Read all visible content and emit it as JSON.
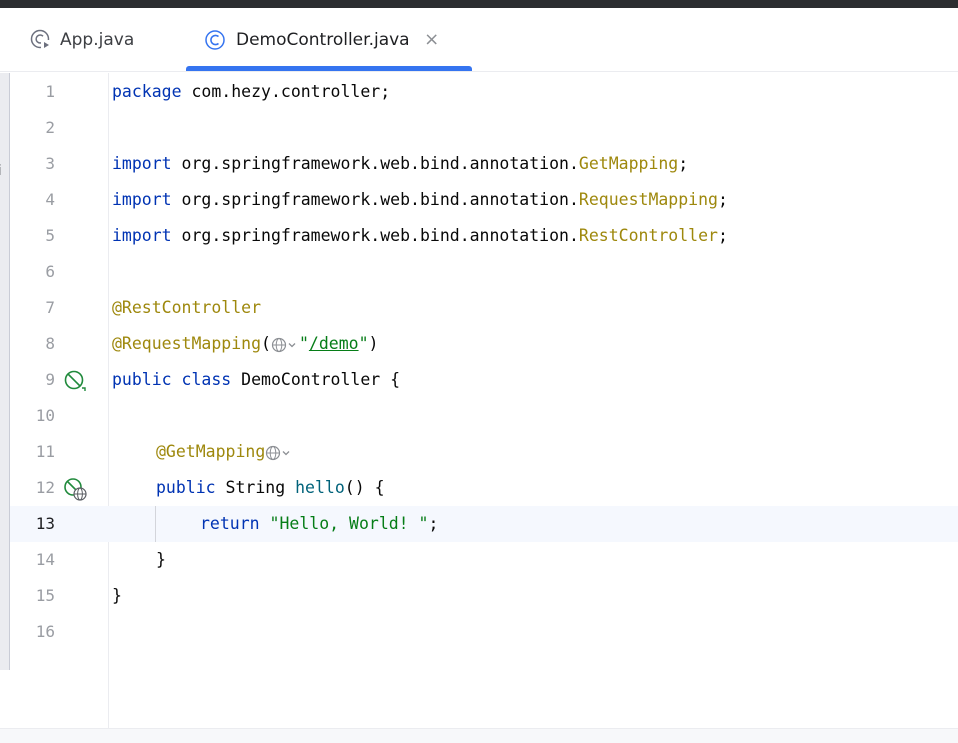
{
  "tabs": [
    {
      "label": "App.java",
      "icon": "java-class-run-icon",
      "active": false
    },
    {
      "label": "DemoController.java",
      "icon": "java-class-icon",
      "active": true,
      "close": "×"
    }
  ],
  "left_strip_text": "i",
  "editor": {
    "current_line": 13,
    "lines": [
      {
        "n": "1"
      },
      {
        "n": "2"
      },
      {
        "n": "3"
      },
      {
        "n": "4"
      },
      {
        "n": "5"
      },
      {
        "n": "6"
      },
      {
        "n": "7"
      },
      {
        "n": "8"
      },
      {
        "n": "9"
      },
      {
        "n": "10"
      },
      {
        "n": "11"
      },
      {
        "n": "12"
      },
      {
        "n": "13"
      },
      {
        "n": "14"
      },
      {
        "n": "15"
      },
      {
        "n": "16"
      }
    ],
    "code": {
      "l1": {
        "kw": "package",
        "rest": " com.hezy.controller;"
      },
      "l3": {
        "kw": "import",
        "pkg": " org.springframework.web.bind.annotation.",
        "cls": "GetMapping",
        "semi": ";"
      },
      "l4": {
        "kw": "import",
        "pkg": " org.springframework.web.bind.annotation.",
        "cls": "RequestMapping",
        "semi": ";"
      },
      "l5": {
        "kw": "import",
        "pkg": " org.springframework.web.bind.annotation.",
        "cls": "RestController",
        "semi": ";"
      },
      "l7": {
        "ann": "@RestController"
      },
      "l8": {
        "ann": "@RequestMapping",
        "open": "(",
        "q1": "\"",
        "url": "/demo",
        "q2": "\"",
        "close": ")"
      },
      "l9": {
        "kw1": "public",
        "kw2": "class",
        "name": " DemoController {"
      },
      "l11": {
        "ann": "@GetMapping"
      },
      "l12": {
        "kw": "public",
        "type": " String ",
        "fn": "hello",
        "rest": "() {"
      },
      "l13": {
        "kw": "return",
        "str": "\"Hello, World! \"",
        "semi": ";"
      },
      "l14": {
        "text": "}"
      },
      "l15": {
        "text": "}"
      }
    }
  },
  "colors": {
    "keyword": "#0033b3",
    "annotation": "#9e880d",
    "string": "#067d17",
    "method": "#00627a",
    "tab_accent": "#3574f0",
    "current_line_bg": "#f5f8fe"
  }
}
